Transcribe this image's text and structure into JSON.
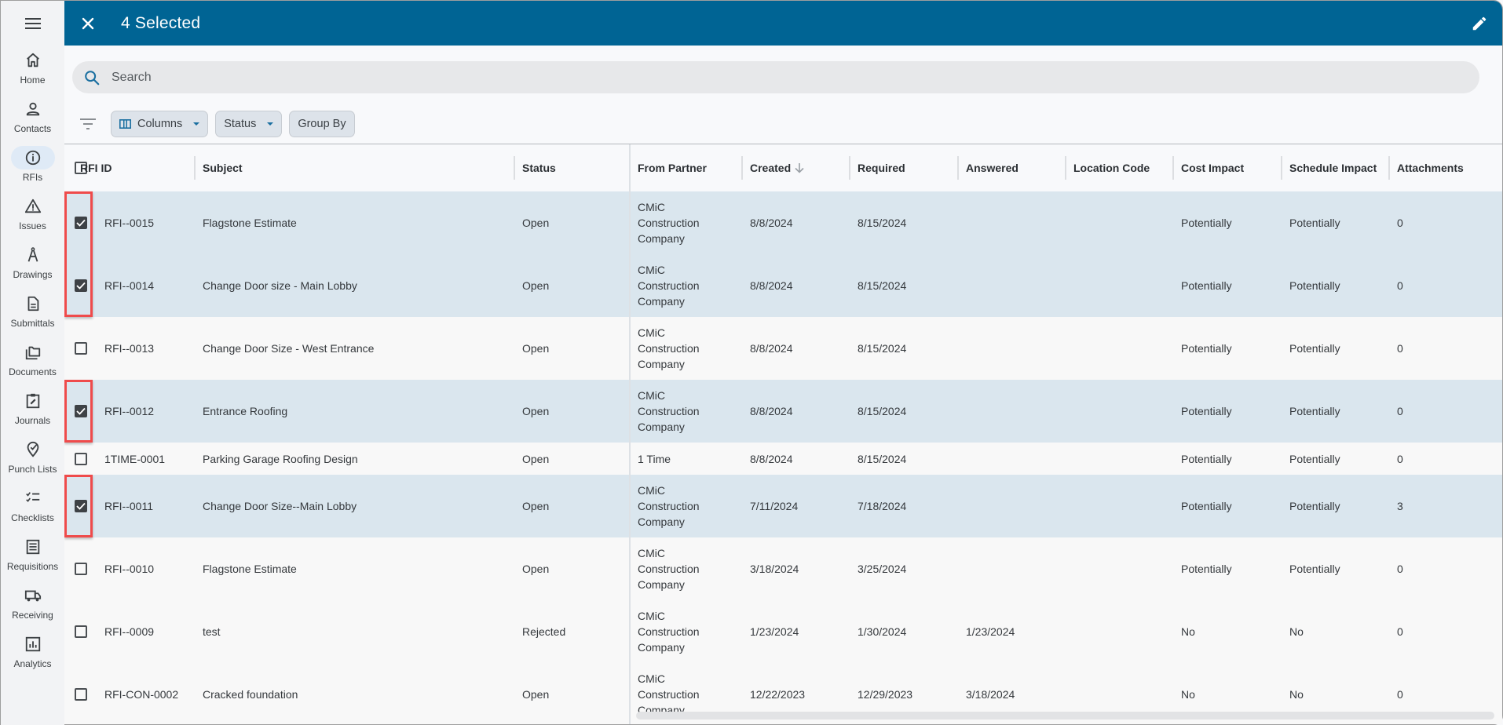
{
  "topbar": {
    "title": "4 Selected",
    "close_icon": "close-icon",
    "edit_icon": "pencil-icon",
    "color": "#006494"
  },
  "sidebar": {
    "menu_icon": "hamburger-icon",
    "active_index": 2,
    "items": [
      {
        "label": "Home",
        "icon": "home-icon"
      },
      {
        "label": "Contacts",
        "icon": "person-icon"
      },
      {
        "label": "RFIs",
        "icon": "info-icon"
      },
      {
        "label": "Issues",
        "icon": "warning-icon"
      },
      {
        "label": "Drawings",
        "icon": "compass-icon"
      },
      {
        "label": "Submittals",
        "icon": "document-icon"
      },
      {
        "label": "Documents",
        "icon": "folders-icon"
      },
      {
        "label": "Journals",
        "icon": "clipboard-edit-icon"
      },
      {
        "label": "Punch Lists",
        "icon": "map-pin-check-icon"
      },
      {
        "label": "Checklists",
        "icon": "checklist-icon"
      },
      {
        "label": "Requisitions",
        "icon": "receipt-icon"
      },
      {
        "label": "Receiving",
        "icon": "truck-icon"
      },
      {
        "label": "Analytics",
        "icon": "bar-chart-icon"
      }
    ]
  },
  "search": {
    "placeholder": "Search",
    "value": ""
  },
  "toolbar": {
    "filter_icon": "filter-icon",
    "columns_label": "Columns",
    "status_label": "Status",
    "group_by_label": "Group By"
  },
  "table": {
    "columns": [
      {
        "key": "id",
        "label": "RFI ID"
      },
      {
        "key": "subject",
        "label": "Subject"
      },
      {
        "key": "status",
        "label": "Status"
      },
      {
        "key": "from_partner",
        "label": "From Partner"
      },
      {
        "key": "created",
        "label": "Created",
        "sort": "desc"
      },
      {
        "key": "required",
        "label": "Required"
      },
      {
        "key": "answered",
        "label": "Answered"
      },
      {
        "key": "location_code",
        "label": "Location Code"
      },
      {
        "key": "cost_impact",
        "label": "Cost Impact"
      },
      {
        "key": "schedule_impact",
        "label": "Schedule Impact"
      },
      {
        "key": "attachments",
        "label": "Attachments"
      }
    ],
    "rows": [
      {
        "selected": true,
        "id": "RFI--0015",
        "subject": "Flagstone Estimate",
        "status": "Open",
        "from_partner": "CMiC Construction Company",
        "created": "8/8/2024",
        "required": "8/15/2024",
        "answered": "",
        "location_code": "",
        "cost_impact": "Potentially",
        "schedule_impact": "Potentially",
        "attachments": "0"
      },
      {
        "selected": true,
        "id": "RFI--0014",
        "subject": "Change Door size - Main Lobby",
        "status": "Open",
        "from_partner": "CMiC Construction Company",
        "created": "8/8/2024",
        "required": "8/15/2024",
        "answered": "",
        "location_code": "",
        "cost_impact": "Potentially",
        "schedule_impact": "Potentially",
        "attachments": "0"
      },
      {
        "selected": false,
        "id": "RFI--0013",
        "subject": "Change Door Size - West Entrance",
        "status": "Open",
        "from_partner": "CMiC Construction Company",
        "created": "8/8/2024",
        "required": "8/15/2024",
        "answered": "",
        "location_code": "",
        "cost_impact": "Potentially",
        "schedule_impact": "Potentially",
        "attachments": "0"
      },
      {
        "selected": true,
        "id": "RFI--0012",
        "subject": "Entrance Roofing",
        "status": "Open",
        "from_partner": "CMiC Construction Company",
        "created": "8/8/2024",
        "required": "8/15/2024",
        "answered": "",
        "location_code": "",
        "cost_impact": "Potentially",
        "schedule_impact": "Potentially",
        "attachments": "0"
      },
      {
        "selected": false,
        "id": "1TIME-0001",
        "subject": "Parking Garage Roofing Design",
        "status": "Open",
        "from_partner": "1 Time",
        "created": "8/8/2024",
        "required": "8/15/2024",
        "answered": "",
        "location_code": "",
        "cost_impact": "Potentially",
        "schedule_impact": "Potentially",
        "attachments": "0"
      },
      {
        "selected": true,
        "id": "RFI--0011",
        "subject": "Change Door Size--Main Lobby",
        "status": "Open",
        "from_partner": "CMiC Construction Company",
        "created": "7/11/2024",
        "required": "7/18/2024",
        "answered": "",
        "location_code": "",
        "cost_impact": "Potentially",
        "schedule_impact": "Potentially",
        "attachments": "3"
      },
      {
        "selected": false,
        "id": "RFI--0010",
        "subject": "Flagstone Estimate",
        "status": "Open",
        "from_partner": "CMiC Construction Company",
        "created": "3/18/2024",
        "required": "3/25/2024",
        "answered": "",
        "location_code": "",
        "cost_impact": "Potentially",
        "schedule_impact": "Potentially",
        "attachments": "0"
      },
      {
        "selected": false,
        "id": "RFI--0009",
        "subject": "test",
        "status": "Rejected",
        "from_partner": "CMiC Construction Company",
        "created": "1/23/2024",
        "required": "1/30/2024",
        "answered": "1/23/2024",
        "location_code": "",
        "cost_impact": "No",
        "schedule_impact": "No",
        "attachments": "0"
      },
      {
        "selected": false,
        "id": "RFI-CON-0002",
        "subject": "Cracked foundation",
        "status": "Open",
        "from_partner": "CMiC Construction Company",
        "created": "12/22/2023",
        "required": "12/29/2023",
        "answered": "3/18/2024",
        "location_code": "",
        "cost_impact": "No",
        "schedule_impact": "No",
        "attachments": "0"
      }
    ]
  },
  "colors": {
    "selected_row": "#dae6ee",
    "highlight_box": "#ef4b4b",
    "accent": "#006494"
  }
}
